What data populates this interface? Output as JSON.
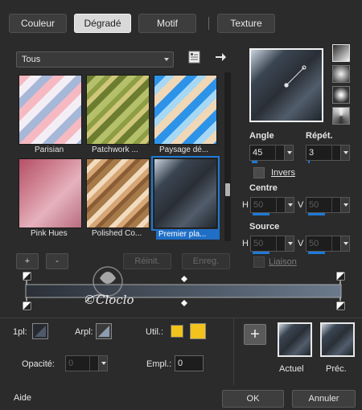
{
  "tabs": [
    {
      "label": "Couleur",
      "active": false
    },
    {
      "label": "Dégradé",
      "active": true
    },
    {
      "label": "Motif",
      "active": false
    },
    {
      "label": "Texture",
      "active": false
    }
  ],
  "gradient_list": {
    "category": "Tous",
    "items": [
      {
        "label": "Parisian"
      },
      {
        "label": "Patchwork ..."
      },
      {
        "label": "Paysage dé..."
      },
      {
        "label": "Pink Hues"
      },
      {
        "label": "Polished Co..."
      },
      {
        "label": "Premier pla...",
        "selected": true
      }
    ]
  },
  "list_buttons": {
    "add": "+",
    "remove": "-",
    "reset": "Réinit.",
    "save": "Enreg."
  },
  "angle": {
    "label": "Angle",
    "value": "45",
    "level": 0.125
  },
  "repeat": {
    "label": "Répét.",
    "value": "3",
    "level": 0.03
  },
  "invert": {
    "label": "Invers",
    "checked": false
  },
  "center": {
    "label": "Centre",
    "h_label": "H",
    "h_value": "50",
    "v_label": "V",
    "v_value": "50"
  },
  "source": {
    "label": "Source",
    "h_label": "H",
    "h_value": "50",
    "v_label": "V",
    "v_value": "50"
  },
  "link": {
    "label": "Liaison",
    "checked": false
  },
  "watermark": {
    "text": "©Cloclo"
  },
  "stops": {
    "opacity_stop_label": "1pl:",
    "background_stop_label": "Arpl:",
    "use_label": "Util.:",
    "opacity_label": "Opacité:",
    "opacity_value": "0",
    "location_label": "Empl.:",
    "location_value": "0",
    "user_color": "#f2c21d"
  },
  "preview": {
    "current_label": "Actuel",
    "previous_label": "Préc.",
    "add": "+"
  },
  "footer": {
    "help": "Aide",
    "ok": "OK",
    "cancel": "Annuler"
  },
  "colors": {
    "accent": "#1f7ad8",
    "background": "#2b2b2b",
    "yellow": "#f2c21d"
  }
}
